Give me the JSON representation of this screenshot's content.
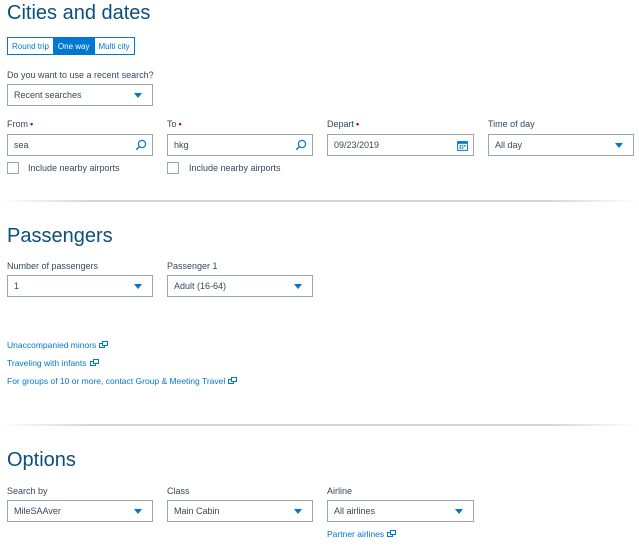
{
  "cities": {
    "title": "Cities and dates",
    "trip_types": [
      "Round trip",
      "One way",
      "Multi city"
    ],
    "selected_trip": "One way",
    "recent_label": "Do you want to use a recent search?",
    "recent_value": "Recent searches",
    "from_label": "From",
    "from_value": "sea",
    "to_label": "To",
    "to_value": "hkg",
    "depart_label": "Depart",
    "depart_value": "09/23/2019",
    "time_label": "Time of day",
    "time_value": "All day",
    "required_mark": "•",
    "nearby_label": "Include nearby airports"
  },
  "passengers": {
    "title": "Passengers",
    "count_label": "Number of passengers",
    "count_value": "1",
    "p1_label": "Passenger 1",
    "p1_value": "Adult (16-64)",
    "links": [
      "Unaccompanied minors",
      "Traveling with infants",
      "For groups of 10 or more, contact Group & Meeting Travel"
    ]
  },
  "options": {
    "title": "Options",
    "search_by_label": "Search by",
    "search_by_value": "MileSAAver",
    "class_label": "Class",
    "class_value": "Main Cabin",
    "airline_label": "Airline",
    "airline_value": "All airlines",
    "partner_link": "Partner airlines"
  },
  "colors": {
    "accent": "#0078d2",
    "heading": "#0b4f7d",
    "required": "#c30019",
    "text": "#36495a"
  },
  "icons": {
    "search": "search-icon",
    "calendar": "calendar-icon",
    "caret": "chevron-down-icon",
    "external": "external-link-icon"
  }
}
